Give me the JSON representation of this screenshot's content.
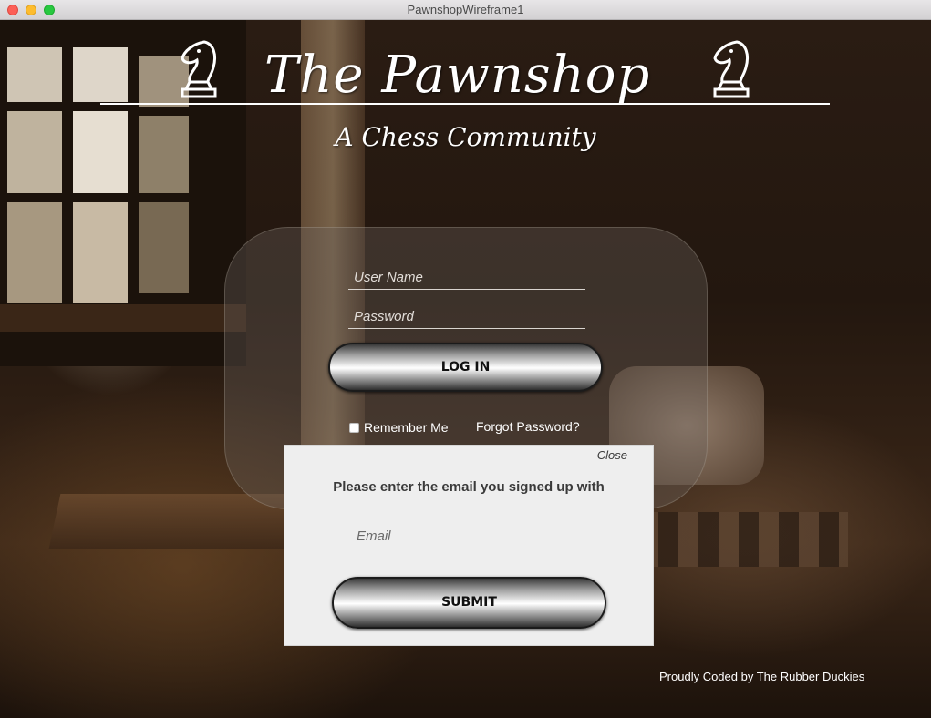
{
  "window": {
    "title": "PawnshopWireframe1"
  },
  "header": {
    "title": "The Pawnshop",
    "subtitle": "A Chess Community",
    "icons": [
      "knight-icon",
      "knight-icon"
    ]
  },
  "login": {
    "username_placeholder": "User Name",
    "password_placeholder": "Password",
    "login_label": "LOG IN",
    "remember_label": "Remember Me",
    "remember_checked": false,
    "forgot_label": "Forgot Password?"
  },
  "forgot_modal": {
    "close_label": "Close",
    "prompt": "Please enter the email you signed up with",
    "email_placeholder": "Email",
    "submit_label": "SUBMIT"
  },
  "footer": {
    "credit": "Proudly Coded by The Rubber Duckies"
  },
  "colors": {
    "text_light": "#ffffff",
    "modal_bg": "#eeeeee",
    "button_chrome": "#c8c8c8"
  }
}
